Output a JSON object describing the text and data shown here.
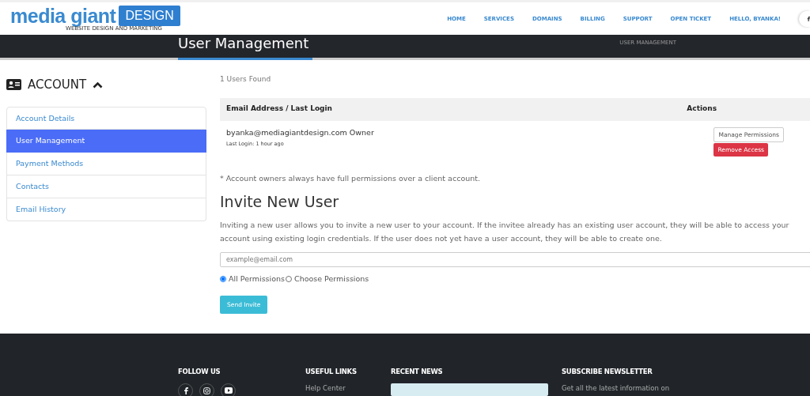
{
  "logo": {
    "name": "media giant",
    "badge": "DESIGN",
    "tagline": "WEBSITE DESIGN AND MARKETING"
  },
  "nav": [
    {
      "label": "HOME"
    },
    {
      "label": "SERVICES"
    },
    {
      "label": "DOMAINS"
    },
    {
      "label": "BILLING"
    },
    {
      "label": "SUPPORT"
    },
    {
      "label": "OPEN TICKET"
    },
    {
      "label": "HELLO, BYANKA!"
    }
  ],
  "page_title": "User Management",
  "breadcrumb": "USER MANAGEMENT",
  "sidebar": {
    "title": "ACCOUNT",
    "expanded": true,
    "items": [
      {
        "label": "Account Details",
        "selected": false
      },
      {
        "label": "User Management",
        "selected": true
      },
      {
        "label": "Payment Methods",
        "selected": false
      },
      {
        "label": "Contacts",
        "selected": false
      },
      {
        "label": "Email History",
        "selected": false
      }
    ]
  },
  "users_found": "1 Users Found",
  "table": {
    "columns": [
      "Email Address / Last Login",
      "Actions"
    ],
    "rows": [
      {
        "email": "byanka@mediagiantdesign.com",
        "role": "Owner",
        "last_login": "Last Login: 1 hour ago",
        "actions": [
          {
            "label": "Manage Permissions",
            "kind": "outline"
          },
          {
            "label": "Remove Access",
            "kind": "danger"
          }
        ]
      }
    ]
  },
  "owner_note": "* Account owners always have full permissions over a client account.",
  "invite": {
    "title": "Invite New User",
    "description": "Inviting a new user allows you to invite a new user to your account. If the invitee already has an existing user account, they will be able to access your account using existing login credentials. If the user does not yet have a user account, they will be able to create one.",
    "email_placeholder": "example@email.com",
    "permissions": [
      {
        "label": "All Permissions",
        "selected": true
      },
      {
        "label": "Choose Permissions",
        "selected": false
      }
    ],
    "button": "Send Invite"
  },
  "footer": {
    "follow_us": "FOLLOW US",
    "useful_links": {
      "title": "USEFUL LINKS",
      "links": [
        "Help Center"
      ]
    },
    "recent_news": {
      "title": "RECENT NEWS"
    },
    "newsletter": {
      "title": "SUBSCRIBE NEWSLETTER",
      "text": "Get all the latest information on"
    }
  }
}
